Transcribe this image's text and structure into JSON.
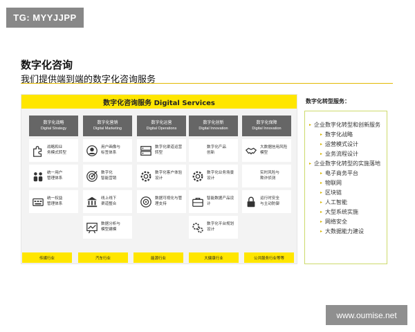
{
  "badge": {
    "label": "TG: MYYJJPP"
  },
  "title": "数字化咨询",
  "subtitle": "我们提供端到端的数字化咨询服务",
  "panel": {
    "header": "数字化咨询服务  Digital Services",
    "columns": [
      {
        "title": "数字化战略",
        "title_en": "Digital Strategy",
        "cells": [
          {
            "icon": "puzzle-icon",
            "text": "战略和业\n务模式转型"
          },
          {
            "icon": "people-icon",
            "text": "统一用户\n管理体系"
          },
          {
            "icon": "keyboard-icon",
            "text": "统一权益\n管理体系"
          }
        ]
      },
      {
        "title": "数字化营销",
        "title_en": "Digital Marketing",
        "cells": [
          {
            "icon": "user-profile-icon",
            "text": "用户画像与\n标签体系"
          },
          {
            "icon": "target-icon",
            "text": "数字化\n智能营销"
          },
          {
            "icon": "bank-icon",
            "text": "线上线下\n渠道整合"
          },
          {
            "icon": "chart-board-icon",
            "text": "数据分析与\n模型建模"
          }
        ]
      },
      {
        "title": "数字化运营",
        "title_en": "Digital Operations",
        "cells": [
          {
            "icon": "server-icon",
            "text": "数字化渠道运营\n转型"
          },
          {
            "icon": "settings-cog-icon",
            "text": "数字化客户体验\n设计"
          },
          {
            "icon": "disc-icon",
            "text": "数据可视化与管\n理支持"
          }
        ]
      },
      {
        "title": "数字化创新",
        "title_en": "Digital Innovation",
        "cells": [
          {
            "icon": "",
            "text": "数字化产品\n创新"
          },
          {
            "icon": "settings-cog-icon",
            "text": "数字化业务场景\n设计"
          },
          {
            "icon": "briefcase-icon",
            "text": "智能数据产品设\n计"
          },
          {
            "icon": "cogs-icon",
            "text": "数字化平台规划\n设计"
          }
        ]
      },
      {
        "title": "数字化保障",
        "title_en": "Digital Innovation",
        "cells": [
          {
            "icon": "handshake-icon",
            "text": "大数据信用风险\n模型"
          },
          {
            "icon": "",
            "text": "实时风险与\n欺诈侦测"
          },
          {
            "icon": "lock-icon",
            "text": "运行时安全\n与主动防御"
          }
        ]
      }
    ],
    "industries": [
      "传媒行业",
      "汽车行业",
      "能源行业",
      "大健康行业",
      "公共服务行业等等"
    ]
  },
  "side": {
    "title": "数字化转型服务：",
    "items": [
      {
        "text": "企业数字化转型和创新服务",
        "level": 1
      },
      {
        "text": "数字化战略",
        "level": 2
      },
      {
        "text": "运营模式设计",
        "level": 2
      },
      {
        "text": "业务流程设计",
        "level": 2
      },
      {
        "text": "企业数字化转型的实施落地",
        "level": 1
      },
      {
        "text": "电子商务平台",
        "level": 2
      },
      {
        "text": "物联网",
        "level": 2
      },
      {
        "text": "区块链",
        "level": 2
      },
      {
        "text": "人工智能",
        "level": 2
      },
      {
        "text": "大型系统实施",
        "level": 2
      },
      {
        "text": "网络安全",
        "level": 2
      },
      {
        "text": "大数据能力建设",
        "level": 2
      }
    ]
  },
  "watermark": "www.oumise.net",
  "colors": {
    "accent": "#ffe600",
    "header_grey": "#666666",
    "bullet": "#d6b400"
  }
}
